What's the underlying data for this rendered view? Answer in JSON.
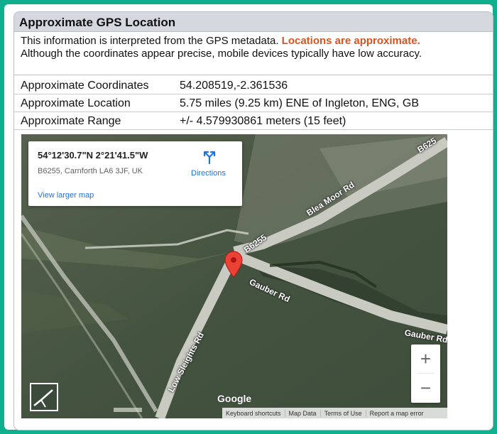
{
  "panel": {
    "title": "Approximate GPS Location",
    "intro_text": "This information is interpreted from the GPS metadata.",
    "intro_warning": "Locations are approximate.",
    "intro_text2": "Although the coordinates appear precise, mobile devices typically have low accuracy."
  },
  "details": [
    {
      "label": "Approximate Coordinates",
      "value": "54.208519,-2.361536"
    },
    {
      "label": "Approximate Location",
      "value": "5.75 miles (9.25 km) ENE of Ingleton, ENG, GB"
    },
    {
      "label": "Approximate Range",
      "value": "+/- 4.579930861 meters (15 feet)"
    }
  ],
  "map": {
    "card": {
      "coords": "54°12'30.7\"N 2°21'41.5\"W",
      "address": "B6255, Carnforth LA6 3JF, UK",
      "directions": "Directions",
      "view_larger": "View larger map"
    },
    "road_labels": [
      "Blea Moor Rd",
      "B6255",
      "Gauber Rd",
      "Gauber Rd",
      "Low Sleights Rd",
      "B625"
    ],
    "zoom_in": "+",
    "zoom_out": "−",
    "logo": "Google",
    "footer": [
      "Keyboard shortcuts",
      "Map Data",
      "Terms of Use",
      "Report a map error"
    ],
    "colors": {
      "pin": "#ea4335",
      "link": "#1a73e8",
      "warning": "#d9531e",
      "background": "#0fae8c"
    }
  }
}
